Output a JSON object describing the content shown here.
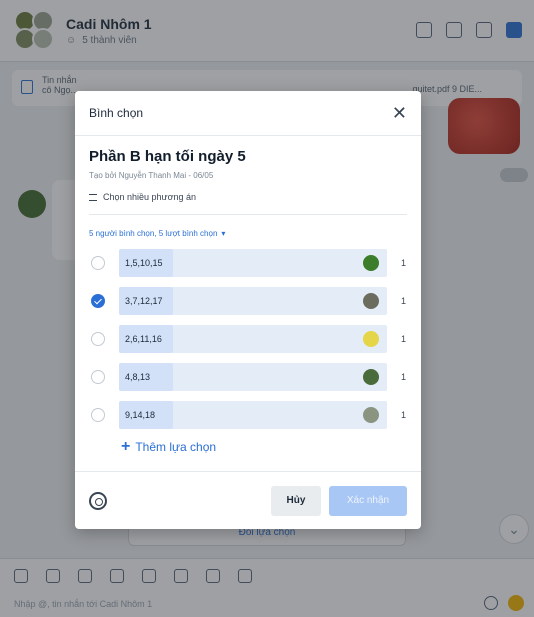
{
  "chat": {
    "title": "Cadi Nhôm 1",
    "members": "5 thành viên",
    "pinned_label": "Tin nhắn",
    "pinned_text": "cô Ngọ...",
    "pinned_right": "guitet.pdf 9 DIE...",
    "poll_card_button": "Đổi lựa chọn",
    "composer_placeholder": "Nhập @, tin nhắn tới Cadi Nhôm 1"
  },
  "modal": {
    "title": "Bình chọn",
    "question": "Phần B hạn tối ngày 5",
    "meta": "Tạo bởi Nguyễn Thanh Mai - 06/05",
    "multi_choice": "Chọn nhiều phương án",
    "vote_summary": "5 người bình chọn, 5 lượt bình chọn",
    "add_option": "Thêm lựa chọn",
    "cancel": "Hủy",
    "confirm": "Xác nhận"
  },
  "options": [
    {
      "label": "1,5,10,15",
      "votes": "1",
      "selected": false,
      "fill": 0.2,
      "avatar_color": "#3b7d2a"
    },
    {
      "label": "3,7,12,17",
      "votes": "1",
      "selected": true,
      "fill": 0.2,
      "avatar_color": "#6b6b5e"
    },
    {
      "label": "2,6,11,16",
      "votes": "1",
      "selected": false,
      "fill": 0.2,
      "avatar_color": "#e4d648"
    },
    {
      "label": "4,8,13",
      "votes": "1",
      "selected": false,
      "fill": 0.2,
      "avatar_color": "#4a6b3a"
    },
    {
      "label": "9,14,18",
      "votes": "1",
      "selected": false,
      "fill": 0.2,
      "avatar_color": "#8a9480"
    }
  ],
  "colors": {
    "accent": "#2a6fd6",
    "option_bar": "#e4ecf7",
    "confirm_disabled": "#a8c7f5"
  }
}
